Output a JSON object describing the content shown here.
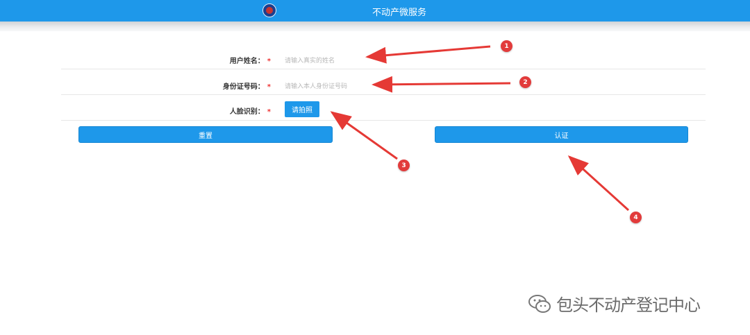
{
  "header": {
    "title": "不动产微服务",
    "logo": "logo-icon"
  },
  "form": {
    "name_label": "用户姓名：",
    "name_placeholder": "请输入真实的姓名",
    "id_label": "身份证号码：",
    "id_placeholder": "请输入本人身份证号码",
    "face_label": "人脸识别：",
    "required_mark": "*",
    "photo_button": "请拍照",
    "reset_button": "重置",
    "auth_button": "认证"
  },
  "markers": [
    "1",
    "2",
    "3",
    "4"
  ],
  "watermark": {
    "text": "包头不动产登记中心",
    "icon": "wechat-icon"
  },
  "colors": {
    "primary": "#1e98ea",
    "marker": "#e23b3b",
    "required": "#ee3333"
  }
}
